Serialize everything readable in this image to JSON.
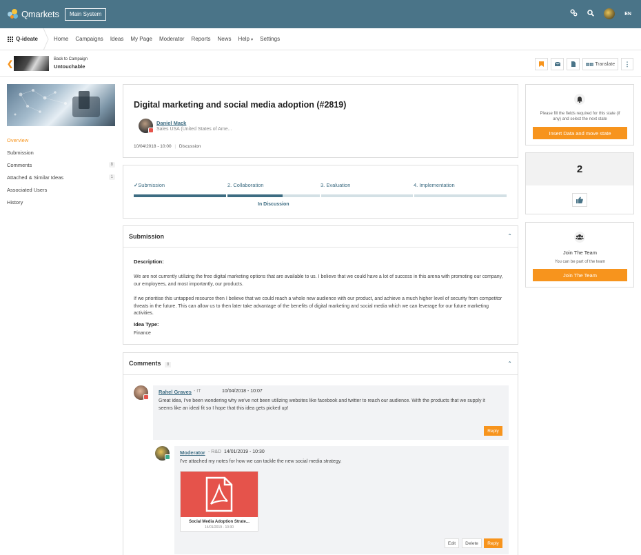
{
  "topbar": {
    "logo_text": "Qmarkets",
    "system_button": "Main System",
    "lang": "EN",
    "icons": [
      "settings-icon",
      "search-icon",
      "avatar",
      "language"
    ]
  },
  "nav": {
    "brand": "Q-ideate",
    "items": [
      "Home",
      "Campaigns",
      "Ideas",
      "My Page",
      "Moderator",
      "Reports",
      "News",
      "Help",
      "Settings"
    ]
  },
  "subheader": {
    "back_text": "Back to Campaign",
    "campaign_name": "Untouchable",
    "translate_label": "Translate"
  },
  "sidebar": {
    "items": [
      {
        "label": "Overview",
        "count": ""
      },
      {
        "label": "Submission",
        "count": ""
      },
      {
        "label": "Comments",
        "count": "8"
      },
      {
        "label": "Attached & Similar Ideas",
        "count": "1"
      },
      {
        "label": "Associated Users",
        "count": ""
      },
      {
        "label": "History",
        "count": ""
      }
    ]
  },
  "idea": {
    "title": "Digital marketing and social media adoption (#2819)",
    "author_name": "Daniel Mack",
    "author_role": "Sales USA (United States of Ame...",
    "date": "10/04/2018 - 10:00",
    "stage": "Discussion"
  },
  "progress": {
    "steps": [
      "Submission",
      "2. Collaboration",
      "3. Evaluation",
      "4. Implementation"
    ],
    "fill_fraction": 0.4,
    "status": "In Discussion"
  },
  "submission": {
    "heading": "Submission",
    "desc_label": "Description:",
    "desc_p1": "We are not currently utilizing the free digital marketing options that are available to us. I believe that we could have a lot of success in this arena with promoting our company, our employees, and most importantly, our products.",
    "desc_p2": "If we prioritise this untapped resource then I believe that we could reach a whole new audience with our product, and achieve a much higher level of security from competitor threats in the future. This can allow us to then later take advantage of the benefits of digital marketing and social media which we can leverage for our future marketing activities.",
    "type_label": "Idea Type:",
    "type_value": "Finance"
  },
  "comments": {
    "heading": "Comments",
    "count": "8",
    "c1": {
      "name": "Rahel Graves",
      "dept": "- IT",
      "date": "10/04/2018 - 10:07",
      "text": "Great idea, I've been wondering why we've not been utilizing websites like facebook and twitter to reach our audience. With the products that we supply it seems like an ideal fit so I hope that this idea gets picked up!",
      "reply": "Reply"
    },
    "c2": {
      "name": "Moderator",
      "dept": "- R&D",
      "date": "14/01/2019 - 10:30",
      "text": "I've attached my notes for how we can tackle the new social media strategy.",
      "file_name": "Social Media Adoption Strate...",
      "file_date": "14/01/2019 - 10:30",
      "edit": "Edit",
      "delete": "Delete",
      "reply": "Reply"
    }
  },
  "right": {
    "state_text": "Please fill the fields required for this state (if any) and select the next state",
    "state_button": "Insert Data and move state",
    "votes": "2",
    "team_title": "Join The Team",
    "team_text": "You can be part of the team",
    "team_button": "Join The Team"
  },
  "colors": {
    "header": "#4a7488",
    "accent": "#f7941d",
    "link": "#3d6c82",
    "pdf": "#e5534b"
  }
}
